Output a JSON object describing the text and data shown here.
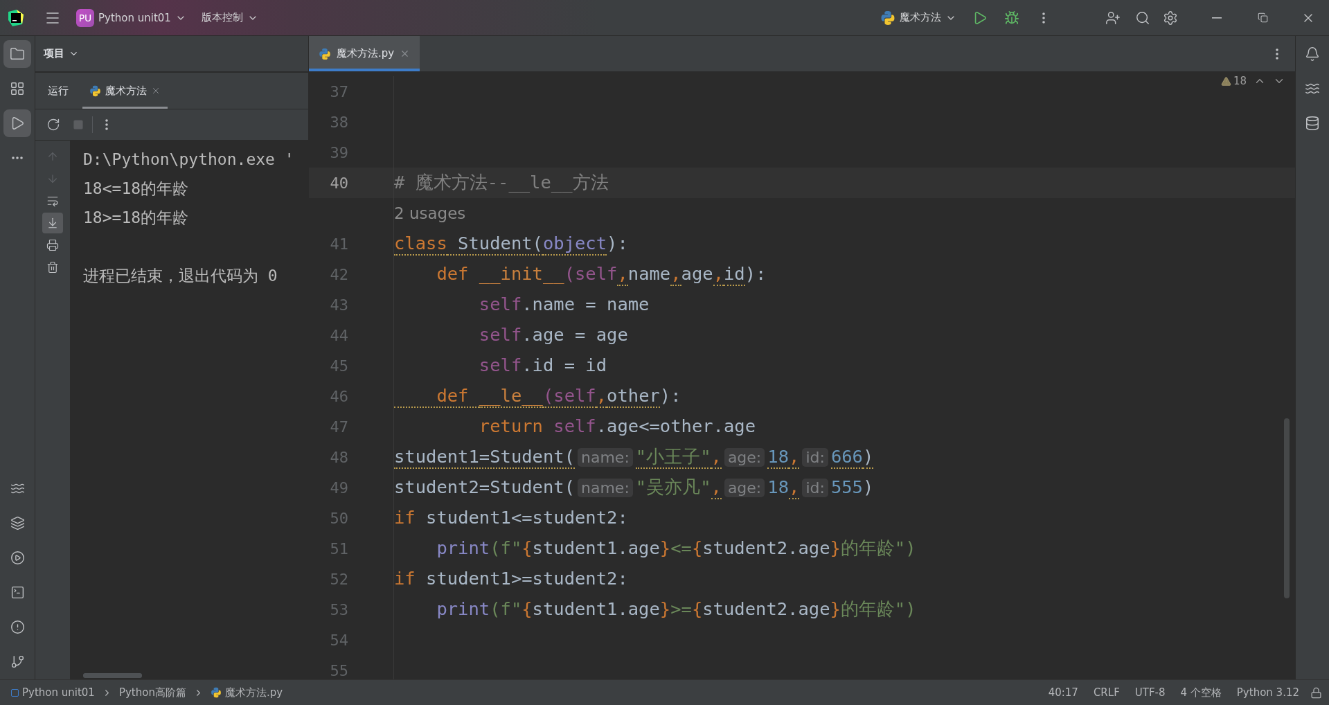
{
  "title_bar": {
    "project_badge": "PU",
    "project": "Python unit01",
    "vcs": "版本控制",
    "run_config": "魔术方法"
  },
  "left_tools_top": [
    {
      "selected": true
    },
    {
      "selected": false
    },
    {
      "selected": true
    },
    {
      "selected": false
    }
  ],
  "project_panel": {
    "title": "项目"
  },
  "run_panel": {
    "tabs": [
      {
        "label": "运行",
        "selected": false
      },
      {
        "label": "魔术方法",
        "selected": true
      }
    ],
    "console_tools": [
      {
        "selected": false
      },
      {
        "selected": false
      },
      {
        "selected": false
      },
      {
        "selected": true
      },
      {
        "selected": false
      },
      {
        "selected": false
      }
    ],
    "console_lines": [
      "D:\\Python\\python.exe '",
      "18<=18的年龄",
      "18>=18的年龄"
    ],
    "exit_message": "进程已结束，退出代码为 0"
  },
  "editor": {
    "tabs": [
      {
        "label": "魔术方法.py",
        "selected": true
      }
    ],
    "warnings": "18",
    "lines": [
      {
        "kind": "code",
        "number": "37",
        "current": false
      },
      {
        "kind": "code",
        "number": "38",
        "current": false
      },
      {
        "kind": "code",
        "number": "39",
        "current": false
      },
      {
        "kind": "code",
        "number": "40",
        "current": true,
        "tokens": [
          {
            "text": "# 魔术方法--__le__方法",
            "kind": "comment",
            "warn": false
          }
        ]
      },
      {
        "kind": "usages",
        "text": "2 usages"
      },
      {
        "kind": "code",
        "number": "41",
        "current": false,
        "tokens": [
          {
            "text": "class",
            "kind": "keyword",
            "warn": true
          },
          {
            "text": " Student(",
            "kind": "plain",
            "warn": true
          },
          {
            "text": "object",
            "kind": "builtin",
            "warn": true
          },
          {
            "text": "):",
            "kind": "plain",
            "warn": false
          }
        ]
      },
      {
        "kind": "code",
        "number": "42",
        "current": false,
        "tokens": [
          {
            "text": "    def ",
            "kind": "keyword",
            "warn": false
          },
          {
            "text": "__init__",
            "kind": "dunder",
            "warn": false
          },
          {
            "text": "(self",
            "kind": "self",
            "warn": false
          },
          {
            "text": ",",
            "kind": "punct",
            "warn": true
          },
          {
            "text": "name",
            "kind": "plain",
            "warn": false
          },
          {
            "text": ",",
            "kind": "punct",
            "warn": true
          },
          {
            "text": "age",
            "kind": "plain",
            "warn": false
          },
          {
            "text": ",",
            "kind": "punct",
            "warn": true
          },
          {
            "text": "id",
            "kind": "plain",
            "warn": true
          },
          {
            "text": "):",
            "kind": "plain",
            "warn": false
          }
        ]
      },
      {
        "kind": "code",
        "number": "43",
        "current": false,
        "tokens": [
          {
            "text": "        self",
            "kind": "self",
            "warn": false
          },
          {
            "text": ".name = name",
            "kind": "plain",
            "warn": false
          }
        ]
      },
      {
        "kind": "code",
        "number": "44",
        "current": false,
        "tokens": [
          {
            "text": "        self",
            "kind": "self",
            "warn": false
          },
          {
            "text": ".age = age",
            "kind": "plain",
            "warn": false
          }
        ]
      },
      {
        "kind": "code",
        "number": "45",
        "current": false,
        "tokens": [
          {
            "text": "        self",
            "kind": "self",
            "warn": false
          },
          {
            "text": ".id = id",
            "kind": "plain",
            "warn": false
          }
        ]
      },
      {
        "kind": "code",
        "number": "46",
        "current": false,
        "tokens": [
          {
            "text": "    def ",
            "kind": "keyword",
            "warn": true
          },
          {
            "text": "__le__",
            "kind": "dunder",
            "warn": true
          },
          {
            "text": "(self",
            "kind": "self",
            "warn": true
          },
          {
            "text": ",",
            "kind": "punct",
            "warn": true
          },
          {
            "text": "other",
            "kind": "plain",
            "warn": true
          },
          {
            "text": "):",
            "kind": "plain",
            "warn": false
          }
        ]
      },
      {
        "kind": "code",
        "number": "47",
        "current": false,
        "tokens": [
          {
            "text": "        return ",
            "kind": "keyword",
            "warn": false
          },
          {
            "text": "self",
            "kind": "self",
            "warn": false
          },
          {
            "text": ".age<=other.age",
            "kind": "plain",
            "warn": false
          }
        ]
      },
      {
        "kind": "code",
        "number": "48",
        "current": false,
        "tokens": [
          {
            "text": "student1=Student(",
            "kind": "plain",
            "warn": true
          },
          {
            "text": "name:",
            "kind": "hint"
          },
          {
            "text": "\"小王子\"",
            "kind": "string",
            "warn": true
          },
          {
            "text": ",",
            "kind": "punct",
            "warn": true
          },
          {
            "text": "age:",
            "kind": "hint"
          },
          {
            "text": "18",
            "kind": "number",
            "warn": true
          },
          {
            "text": ",",
            "kind": "punct",
            "warn": true
          },
          {
            "text": "id:",
            "kind": "hint"
          },
          {
            "text": "666",
            "kind": "number",
            "warn": true
          },
          {
            "text": ")",
            "kind": "plain",
            "warn": true
          }
        ]
      },
      {
        "kind": "code",
        "number": "49",
        "current": false,
        "tokens": [
          {
            "text": "student2=Student(",
            "kind": "plain",
            "warn": false
          },
          {
            "text": "name:",
            "kind": "hint"
          },
          {
            "text": "\"吴亦凡\"",
            "kind": "string",
            "warn": false
          },
          {
            "text": ",",
            "kind": "punct",
            "warn": true
          },
          {
            "text": "age:",
            "kind": "hint"
          },
          {
            "text": "18",
            "kind": "number",
            "warn": false
          },
          {
            "text": ",",
            "kind": "punct",
            "warn": true
          },
          {
            "text": "id:",
            "kind": "hint"
          },
          {
            "text": "555",
            "kind": "number",
            "warn": false
          },
          {
            "text": ")",
            "kind": "plain",
            "warn": false
          }
        ]
      },
      {
        "kind": "code",
        "number": "50",
        "current": false,
        "tokens": [
          {
            "text": "if",
            "kind": "keyword",
            "warn": false
          },
          {
            "text": " student1<=student2:",
            "kind": "plain",
            "warn": false
          }
        ]
      },
      {
        "kind": "code",
        "number": "51",
        "current": false,
        "tokens": [
          {
            "text": "    print",
            "kind": "builtin",
            "warn": false
          },
          {
            "text": "(f\"",
            "kind": "string",
            "warn": false
          },
          {
            "text": "{",
            "kind": "brace",
            "warn": false
          },
          {
            "text": "student1.age",
            "kind": "plain",
            "warn": false
          },
          {
            "text": "}",
            "kind": "brace",
            "warn": false
          },
          {
            "text": "<=",
            "kind": "string",
            "warn": false
          },
          {
            "text": "{",
            "kind": "brace",
            "warn": false
          },
          {
            "text": "student2.age",
            "kind": "plain",
            "warn": false
          },
          {
            "text": "}",
            "kind": "brace",
            "warn": false
          },
          {
            "text": "的年龄\")",
            "kind": "string",
            "warn": false
          }
        ]
      },
      {
        "kind": "code",
        "number": "52",
        "current": false,
        "tokens": [
          {
            "text": "if",
            "kind": "keyword",
            "warn": false
          },
          {
            "text": " student1>=student2:",
            "kind": "plain",
            "warn": false
          }
        ]
      },
      {
        "kind": "code",
        "number": "53",
        "current": false,
        "tokens": [
          {
            "text": "    print",
            "kind": "builtin",
            "warn": false
          },
          {
            "text": "(f\"",
            "kind": "string",
            "warn": false
          },
          {
            "text": "{",
            "kind": "brace",
            "warn": false
          },
          {
            "text": "student1.age",
            "kind": "plain",
            "warn": false
          },
          {
            "text": "}",
            "kind": "brace",
            "warn": false
          },
          {
            "text": ">=",
            "kind": "string",
            "warn": false
          },
          {
            "text": "{",
            "kind": "brace",
            "warn": false
          },
          {
            "text": "student2.age",
            "kind": "plain",
            "warn": false
          },
          {
            "text": "}",
            "kind": "brace",
            "warn": false
          },
          {
            "text": "的年龄\")",
            "kind": "string",
            "warn": false
          }
        ]
      },
      {
        "kind": "code",
        "number": "54",
        "current": false
      },
      {
        "kind": "code",
        "number": "55",
        "current": false
      }
    ]
  },
  "status_bar": {
    "breadcrumbs": [
      "Python unit01",
      "Python高阶篇",
      "魔术方法.py"
    ],
    "items": [
      "40:17",
      "CRLF",
      "UTF-8",
      "4 个空格",
      "Python 3.12"
    ]
  }
}
